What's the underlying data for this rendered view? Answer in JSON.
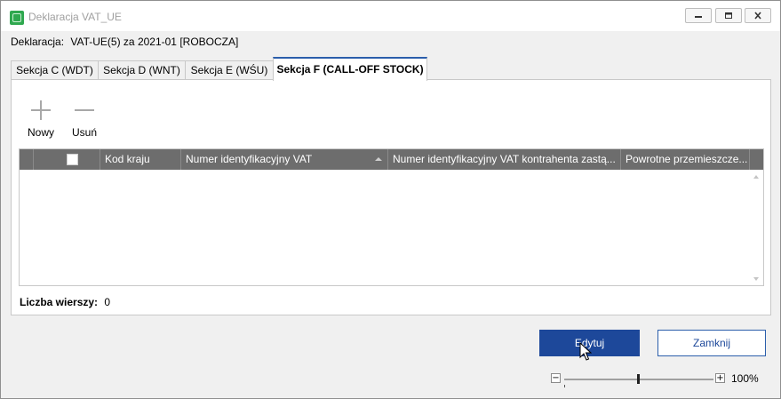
{
  "window": {
    "title": "Deklaracja VAT_UE",
    "controls": [
      "minimize-icon",
      "maximize-icon",
      "close-icon"
    ]
  },
  "declaration": {
    "label": "Deklaracja:",
    "value": "VAT-UE(5) za 2021-01 [ROBOCZA]"
  },
  "tabs": [
    {
      "label": "Sekcja C (WDT)",
      "active": false
    },
    {
      "label": "Sekcja D (WNT)",
      "active": false
    },
    {
      "label": "Sekcja E (WŚU)",
      "active": false
    },
    {
      "label": "Sekcja F (CALL-OFF STOCK)",
      "active": true
    }
  ],
  "toolbar": {
    "new_label": "Nowy",
    "new_icon": "plus-icon",
    "delete_label": "Usuń",
    "delete_icon": "minus-icon"
  },
  "grid": {
    "columns": [
      "Kod kraju",
      "Numer identyfikacyjny VAT",
      "Numer identyfikacyjny VAT kontrahenta zastą...",
      "Powrotne przemieszcze..."
    ],
    "sorted_column": "Numer identyfikacyjny VAT",
    "sort_direction": "ascending",
    "rows": [],
    "header_color": "#6d6d6d"
  },
  "row_count": {
    "label": "Liczba wierszy:",
    "value": "0"
  },
  "buttons": {
    "edit_label": "Edytuj",
    "close_label": "Zamknij",
    "primary_color": "#1d489a"
  },
  "zoom": {
    "minus": "−",
    "plus": "+",
    "level": "100%",
    "slider_fraction": 0.5
  }
}
